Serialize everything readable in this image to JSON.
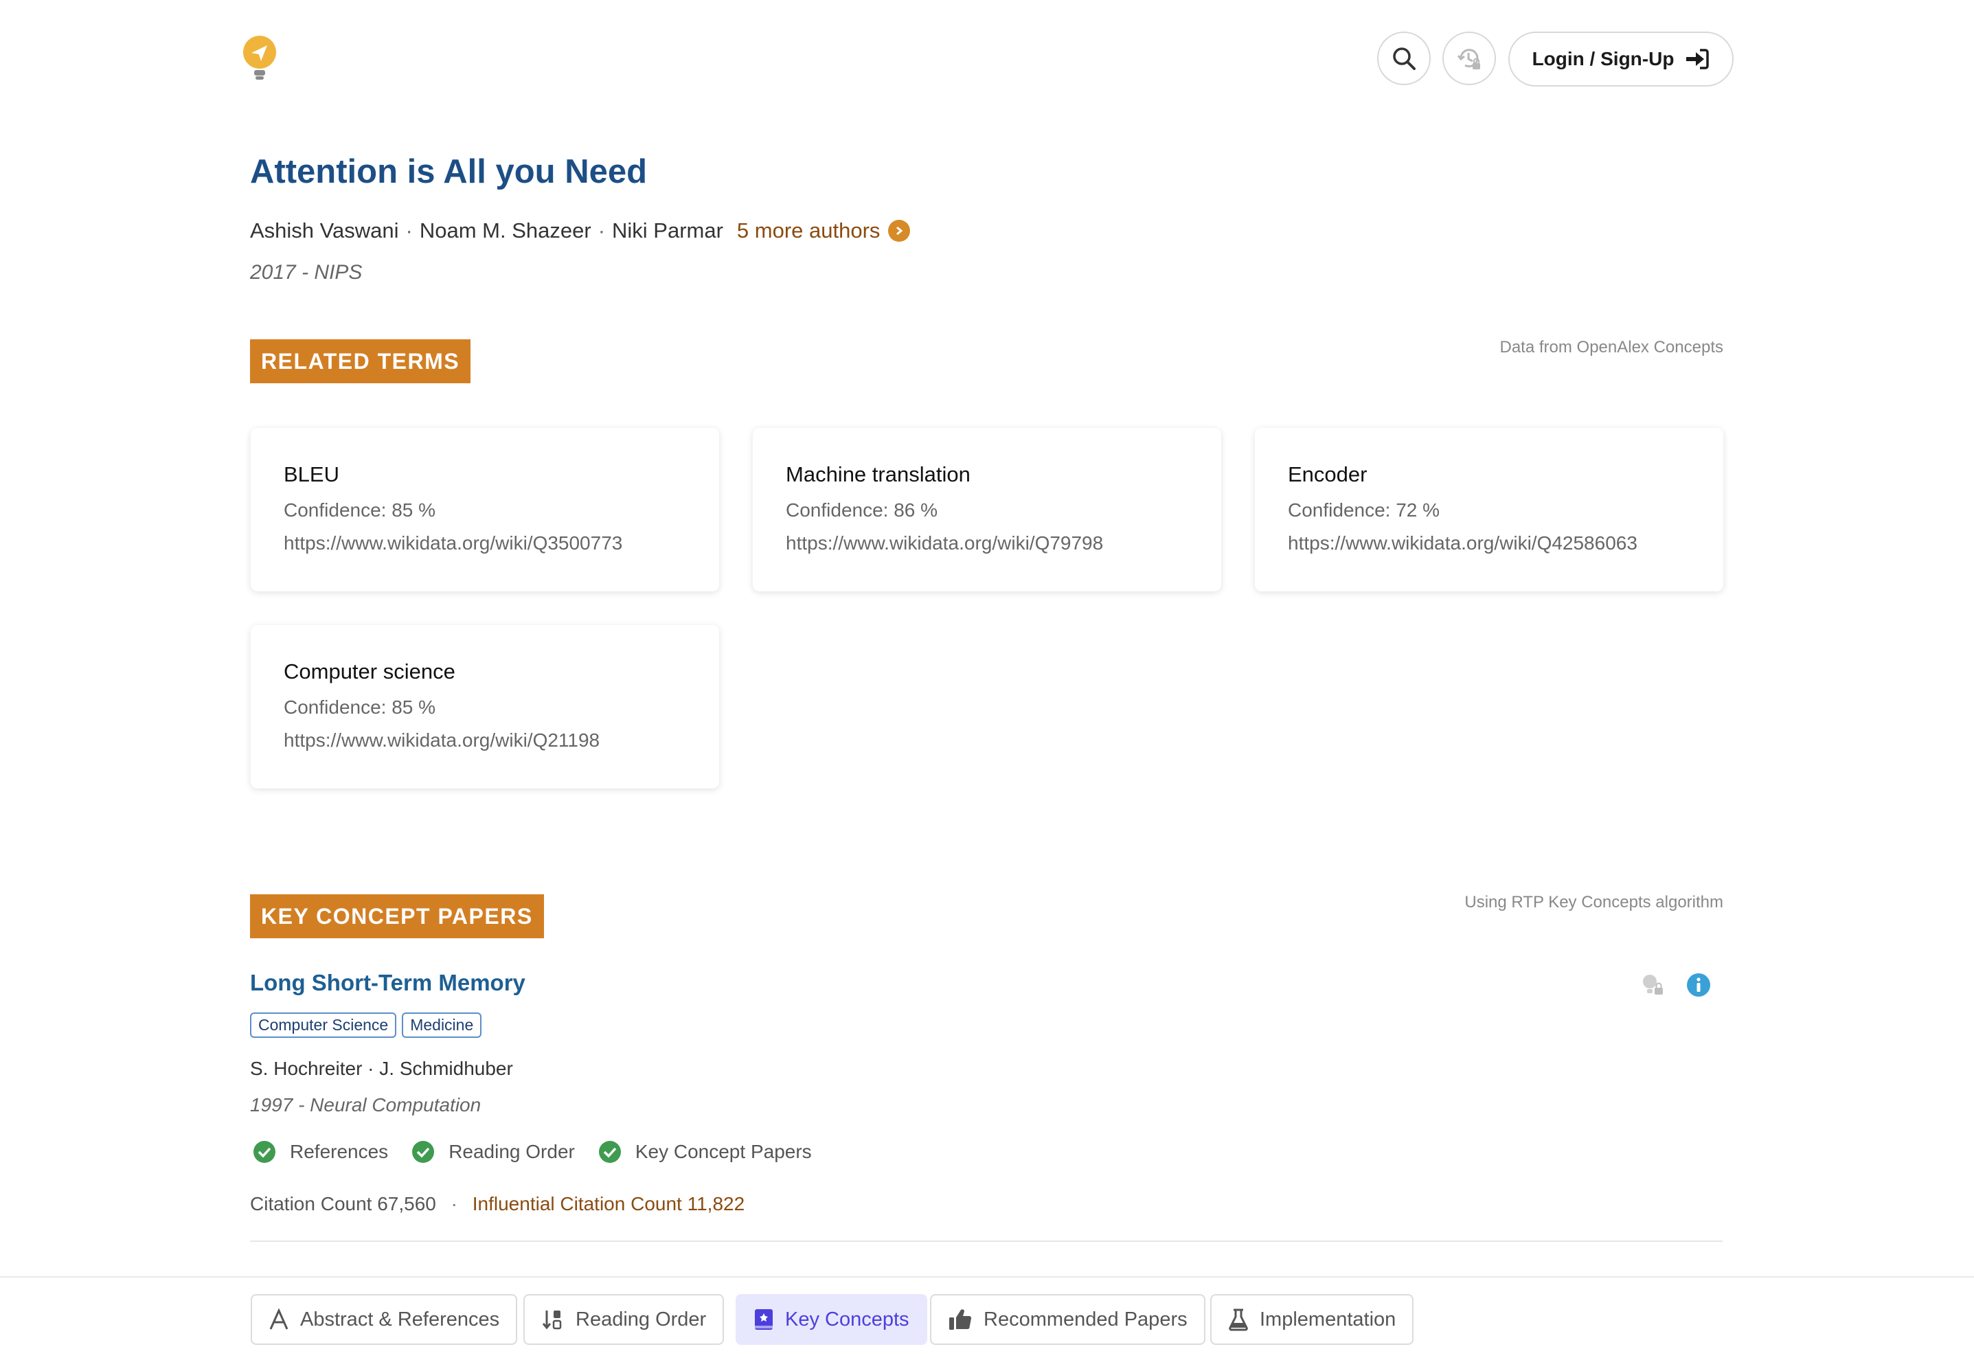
{
  "header": {
    "login_label": "Login / Sign-Up",
    "icons": [
      "logo-icon",
      "search-icon",
      "history-icon",
      "login-icon"
    ]
  },
  "paper": {
    "title": "Attention is All you Need",
    "authors": [
      "Ashish Vaswani",
      "Noam M. Shazeer",
      "Niki Parmar"
    ],
    "separator": "·",
    "more_authors": "5 more authors",
    "year_venue": "2017 - NIPS"
  },
  "related_terms": {
    "badge": "RELATED TERMS",
    "source": "Data from OpenAlex Concepts",
    "cards": [
      {
        "name": "BLEU",
        "confidence": "Confidence: 85 %",
        "url": "https://www.wikidata.org/wiki/Q3500773"
      },
      {
        "name": "Machine translation",
        "confidence": "Confidence: 86 %",
        "url": "https://www.wikidata.org/wiki/Q79798"
      },
      {
        "name": "Encoder",
        "confidence": "Confidence: 72 %",
        "url": "https://www.wikidata.org/wiki/Q42586063"
      },
      {
        "name": "Computer science",
        "confidence": "Confidence: 85 %",
        "url": "https://www.wikidata.org/wiki/Q21198"
      }
    ]
  },
  "key_concepts": {
    "badge": "KEY CONCEPT PAPERS",
    "source": "Using RTP Key Concepts algorithm",
    "paper": {
      "title": "Long Short-Term Memory",
      "tags": [
        "Computer Science",
        "Medicine"
      ],
      "authors": "S. Hochreiter · J. Schmidhuber",
      "year_venue": "1997 - Neural Computation",
      "checks": [
        "References",
        "Reading Order",
        "Key Concept Papers"
      ],
      "citation_count": "Citation Count 67,560",
      "dot": "·",
      "influential_count": "Influential Citation Count 11,822"
    }
  },
  "bottom_tabs": [
    {
      "label": "Abstract & References",
      "icon": "abstract-icon",
      "active": false
    },
    {
      "label": "Reading Order",
      "icon": "sort-icon",
      "active": false
    },
    {
      "label": "Key Concepts",
      "icon": "book-icon",
      "active": true
    },
    {
      "label": "Recommended Papers",
      "icon": "thumbs-up-icon",
      "active": false
    },
    {
      "label": "Implementation",
      "icon": "flask-icon",
      "active": false
    }
  ],
  "colors": {
    "accent_orange": "#d27f24",
    "title_blue": "#1d4f86",
    "link_brown": "#8a4b0f",
    "check_green": "#3f9b4f",
    "active_tab_bg": "#e7e8fd",
    "active_tab_text": "#4c3fdc"
  }
}
